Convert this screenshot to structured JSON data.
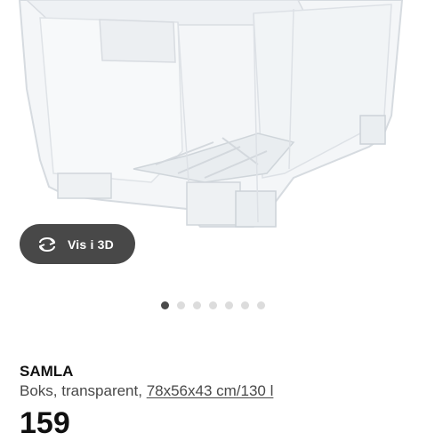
{
  "image": {
    "description_icon": "transparent-storage-box-image"
  },
  "view_3d_button": {
    "label": "Vis i 3D",
    "icon": "rotate-3d-icon"
  },
  "carousel": {
    "total": 7,
    "active_index": 0
  },
  "product": {
    "name": "SAMLA",
    "description_prefix": "Boks, transparent, ",
    "dimensions": "78x56x43 cm/130 l",
    "price": "159"
  },
  "colors": {
    "button_bg": "#484848",
    "dot_active": "#4a4a4a",
    "dot_inactive": "#dcdcdc"
  }
}
